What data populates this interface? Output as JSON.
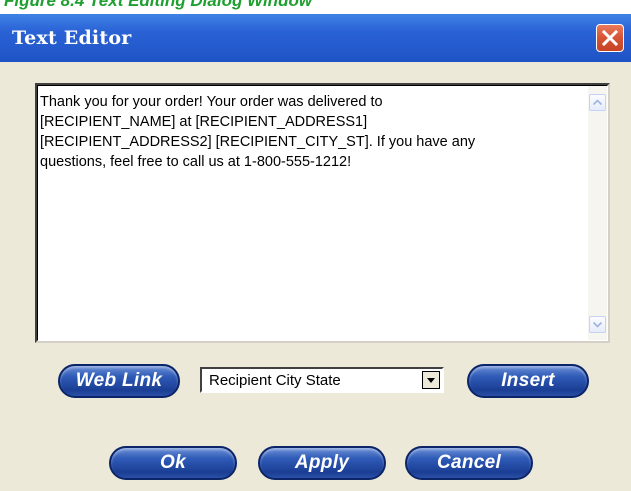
{
  "page": {
    "top_strip_text": "Figure 8.4 Text Editing Dialog Window"
  },
  "window": {
    "title": "Text Editor",
    "close_icon": "close-icon",
    "title_bar_color": "#2a63d6",
    "close_button_color": "#d65434"
  },
  "editor": {
    "text": "Thank you for your order! Your order was delivered to\n[RECIPIENT_NAME] at [RECIPIENT_ADDRESS1]\n[RECIPIENT_ADDRESS2] [RECIPIENT_CITY_ST]. If you have any\nquestions, feel free to call us at 1-800-555-1212!",
    "scroll_up_icon": "scroll-up-arrow-icon",
    "scroll_down_icon": "scroll-down-arrow-icon"
  },
  "toolbar": {
    "web_link_label": "Web Link",
    "field_select_value": "Recipient City State",
    "dropdown_icon": "dropdown-arrow-icon",
    "insert_label": "Insert"
  },
  "footer": {
    "ok_label": "Ok",
    "apply_label": "Apply",
    "cancel_label": "Cancel"
  },
  "colors": {
    "button_blue": "#1b3e95",
    "dialog_background": "#ece9d8"
  }
}
